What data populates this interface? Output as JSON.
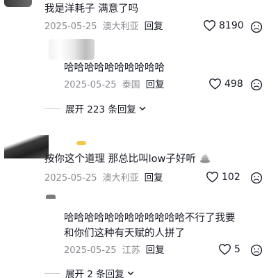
{
  "comments": [
    {
      "text": "我是洋耗子 满意了吗",
      "date": "2025-05-25",
      "location": "澳大利亚",
      "reply_label": "回复",
      "likes": "8190"
    },
    {
      "text": "哈哈哈哈哈哈哈哈哈哈",
      "date": "2025-05-25",
      "location": "泰国",
      "reply_label": "回复",
      "likes": "498"
    },
    {
      "text": "按你这个道理 那总比叫low子好听",
      "date": "2025-05-25",
      "location": "澳大利亚",
      "reply_label": "回复",
      "likes": "102"
    },
    {
      "text_line1": "哈哈哈哈哈哈哈哈哈哈哈哈不行了我要",
      "text_line2": "和你们这种有天赋的人拼了",
      "date": "2025-05-25",
      "location": "江苏",
      "reply_label": "回复",
      "likes": "5"
    }
  ],
  "expand_replies": [
    {
      "label": "展开 223 条回复"
    },
    {
      "label": "展开 2 条回复"
    }
  ],
  "icons": {
    "like": "heart-outline-icon",
    "dislike": "frown-face-icon",
    "expand": "chevron-down-icon",
    "emoji": "poop-emoji-icon"
  },
  "colors": {
    "text_primary": "#161823",
    "text_secondary": "#8a8b91",
    "divider": "#cfcfd3",
    "background": "#ffffff"
  }
}
